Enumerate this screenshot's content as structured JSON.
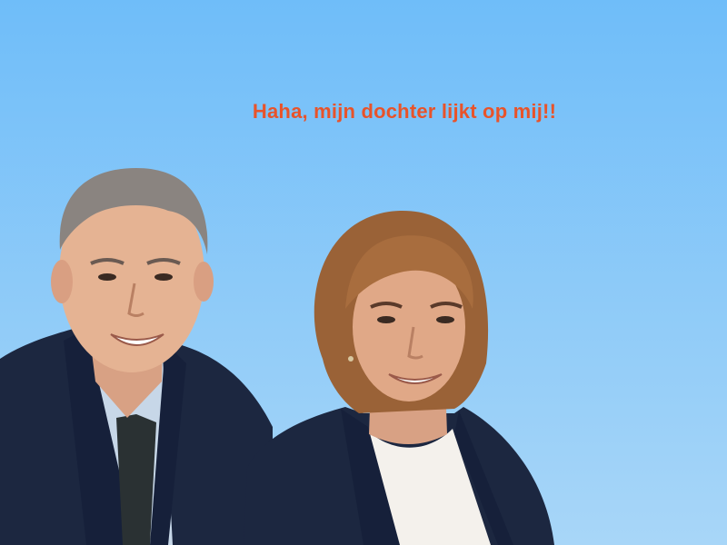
{
  "caption": {
    "text": "Haha, mijn dochter lijkt op mij!!",
    "color": "#e8532a"
  },
  "colors": {
    "sky_top": "#6fbdf9",
    "sky_bottom": "#a8d6f8",
    "suit_navy": "#1c2740",
    "shirt_light_blue": "#c7d7e8",
    "blouse_white": "#f4f1ec",
    "skin": "#e5b393",
    "hair_grey": "#8a8480",
    "hair_auburn": "#9a6237"
  },
  "figures": [
    {
      "name": "man-in-suit",
      "icon": "person-man"
    },
    {
      "name": "woman-in-blazer",
      "icon": "person-woman"
    }
  ]
}
